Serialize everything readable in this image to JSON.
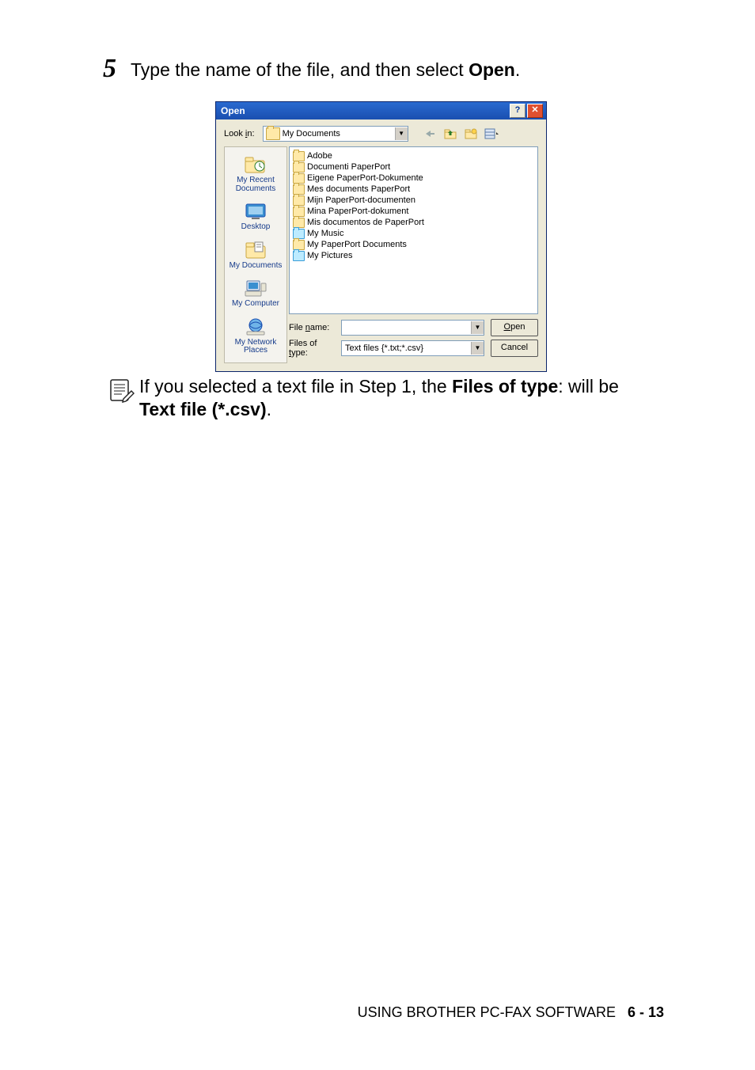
{
  "step": {
    "number": "5",
    "prefix": "Type the name of the file, and then select ",
    "bold": "Open",
    "suffix": "."
  },
  "dialog": {
    "title": "Open",
    "lookin_label_pre": "Look ",
    "lookin_label_u": "i",
    "lookin_label_post": "n:",
    "lookin_value": "My Documents",
    "places": [
      "My Recent Documents",
      "Desktop",
      "My Documents",
      "My Computer",
      "My Network Places"
    ],
    "files": [
      {
        "name": "Adobe",
        "special": false
      },
      {
        "name": "Documenti PaperPort",
        "special": false
      },
      {
        "name": "Eigene PaperPort-Dokumente",
        "special": false
      },
      {
        "name": "Mes documents PaperPort",
        "special": false
      },
      {
        "name": "Mijn PaperPort-documenten",
        "special": false
      },
      {
        "name": "Mina PaperPort-dokument",
        "special": false
      },
      {
        "name": "Mis documentos de PaperPort",
        "special": false
      },
      {
        "name": "My Music",
        "special": true
      },
      {
        "name": "My PaperPort Documents",
        "special": false
      },
      {
        "name": "My Pictures",
        "special": true
      }
    ],
    "filename_label_pre": "File ",
    "filename_label_u": "n",
    "filename_label_post": "ame:",
    "filename_value": "",
    "filetype_label_pre": "Files of ",
    "filetype_label_u": "t",
    "filetype_label_post": "ype:",
    "filetype_value": "Text files {*.txt;*.csv}",
    "open_btn_u": "O",
    "open_btn_post": "pen",
    "cancel_btn": "Cancel"
  },
  "note": {
    "line1_pre": "If you selected a text file in Step 1, the ",
    "line1_bold": "Files of type",
    "line1_post": ": will be ",
    "line2_bold": "Text file (*.csv)",
    "line2_post": "."
  },
  "footer": {
    "text": "USING BROTHER PC-FAX SOFTWARE",
    "page": "6 - 13"
  }
}
